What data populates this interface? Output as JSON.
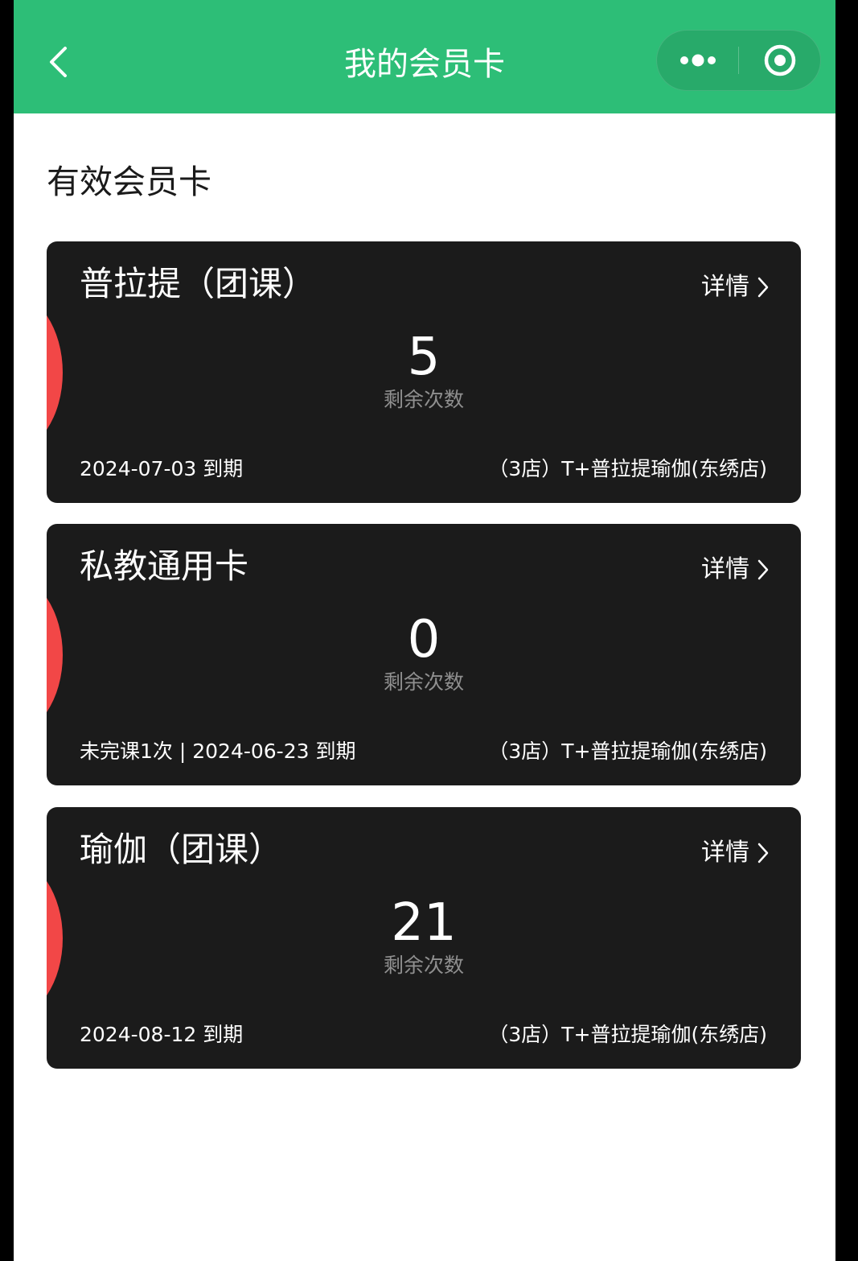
{
  "navbar": {
    "title": "我的会员卡",
    "back_icon": "chevron-left-icon",
    "more_icon": "more-dots-icon",
    "close_icon": "record-circle-icon",
    "background_color": "#2dbe77"
  },
  "section": {
    "title": "有效会员卡"
  },
  "cards": [
    {
      "name": "普拉提（团课）",
      "detail_label": "详情",
      "remaining_count": "5",
      "remaining_label": "剩余次数",
      "expiry": "2024-07-03 到期",
      "store": "（3店）T+普拉提瑜伽(东绣店)"
    },
    {
      "name": "私教通用卡",
      "detail_label": "详情",
      "remaining_count": "0",
      "remaining_label": "剩余次数",
      "expiry": "未完课1次 | 2024-06-23 到期",
      "store": "（3店）T+普拉提瑜伽(东绣店)"
    },
    {
      "name": "瑜伽（团课）",
      "detail_label": "详情",
      "remaining_count": "21",
      "remaining_label": "剩余次数",
      "expiry": "2024-08-12 到期",
      "store": "（3店）T+普拉提瑜伽(东绣店)"
    }
  ],
  "colors": {
    "card_background": "#1b1b1b",
    "card_accent": "#f24747",
    "muted_text": "#8f8f8f"
  }
}
